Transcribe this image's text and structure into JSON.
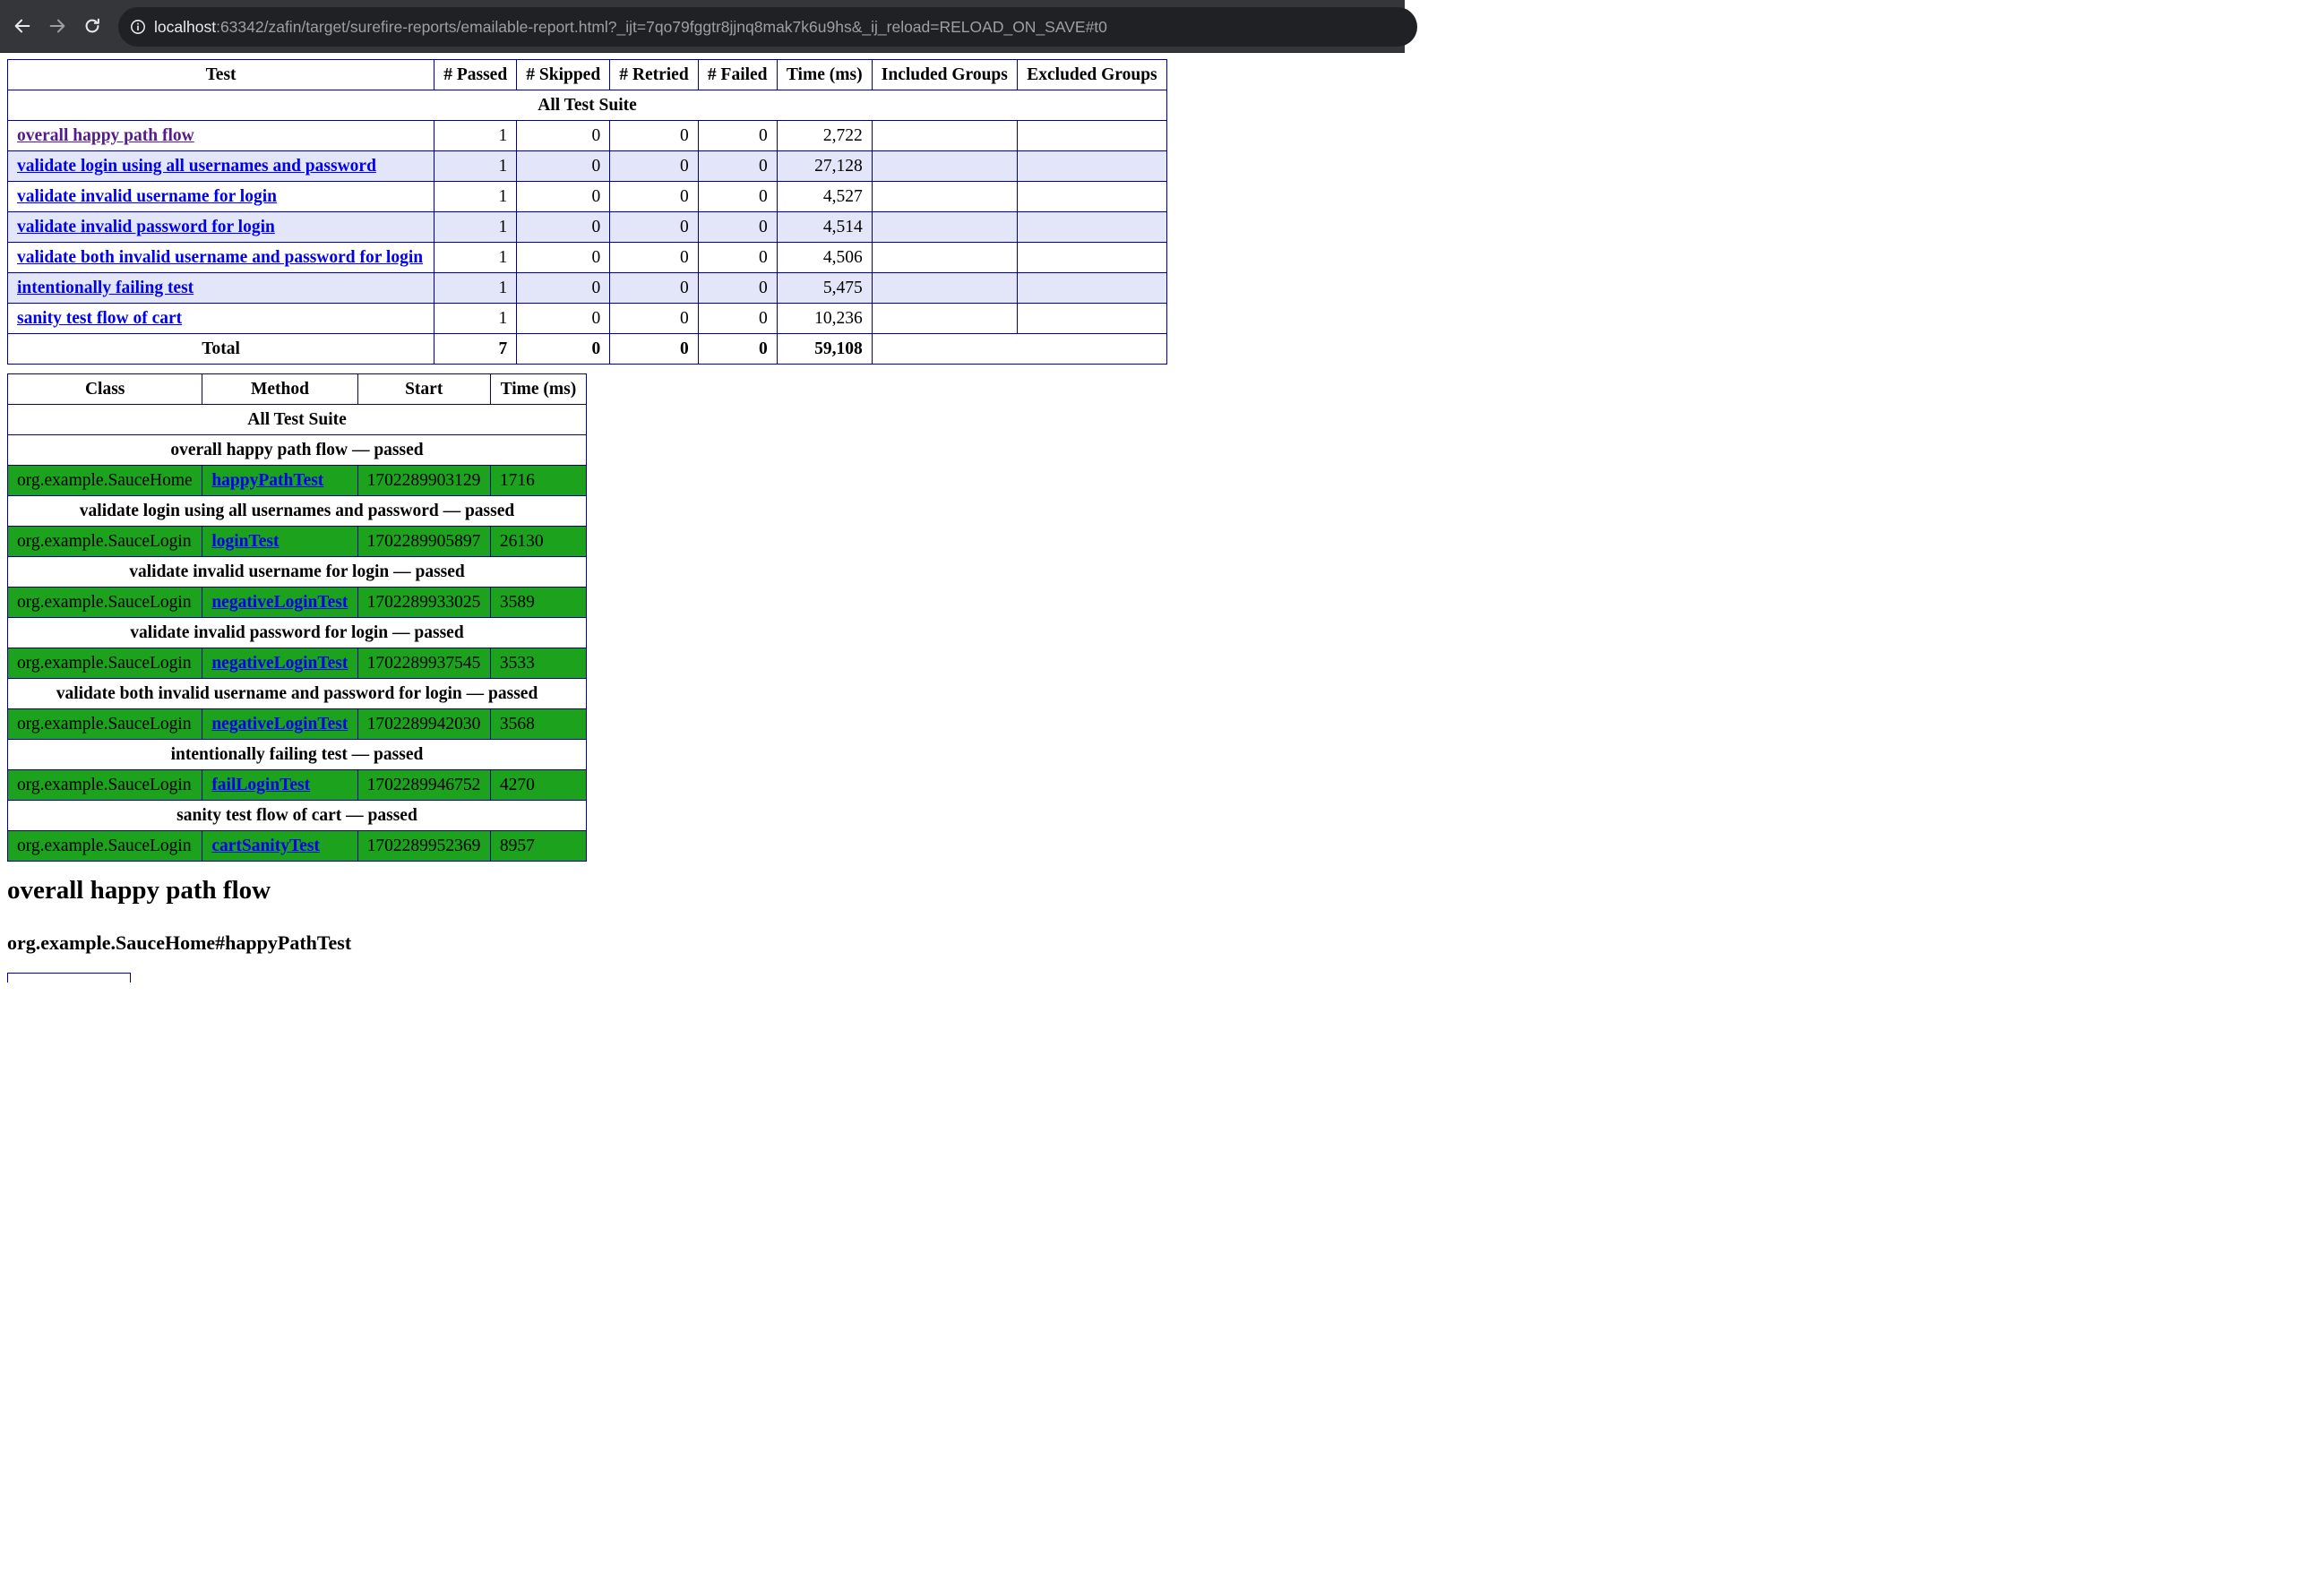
{
  "browser": {
    "url_host": "localhost",
    "url_rest": ":63342/zafin/target/surefire-reports/emailable-report.html?_ijt=7qo79fggtr8jjnq8mak7k6u9hs&_ij_reload=RELOAD_ON_SAVE#t0"
  },
  "summary": {
    "headers": [
      "Test",
      "# Passed",
      "# Skipped",
      "# Retried",
      "# Failed",
      "Time (ms)",
      "Included Groups",
      "Excluded Groups"
    ],
    "suite": "All Test Suite",
    "rows": [
      {
        "name": "overall happy path flow",
        "passed": "1",
        "skipped": "0",
        "retried": "0",
        "failed": "0",
        "time": "2,722"
      },
      {
        "name": "validate login using all usernames and password",
        "passed": "1",
        "skipped": "0",
        "retried": "0",
        "failed": "0",
        "time": "27,128"
      },
      {
        "name": "validate invalid username for login",
        "passed": "1",
        "skipped": "0",
        "retried": "0",
        "failed": "0",
        "time": "4,527"
      },
      {
        "name": "validate invalid password for login",
        "passed": "1",
        "skipped": "0",
        "retried": "0",
        "failed": "0",
        "time": "4,514"
      },
      {
        "name": "validate both invalid username and password for login",
        "passed": "1",
        "skipped": "0",
        "retried": "0",
        "failed": "0",
        "time": "4,506"
      },
      {
        "name": "intentionally failing test",
        "passed": "1",
        "skipped": "0",
        "retried": "0",
        "failed": "0",
        "time": "5,475"
      },
      {
        "name": "sanity test flow of cart",
        "passed": "1",
        "skipped": "0",
        "retried": "0",
        "failed": "0",
        "time": "10,236"
      }
    ],
    "total": {
      "label": "Total",
      "passed": "7",
      "skipped": "0",
      "retried": "0",
      "failed": "0",
      "time": "59,108"
    }
  },
  "detail": {
    "headers": [
      "Class",
      "Method",
      "Start",
      "Time (ms)"
    ],
    "suite": "All Test Suite",
    "groups": [
      {
        "title": "overall happy path flow — passed",
        "class": "org.example.SauceHome",
        "method": "happyPathTest",
        "start": "1702289903129",
        "time": "1716"
      },
      {
        "title": "validate login using all usernames and password — passed",
        "class": "org.example.SauceLogin",
        "method": "loginTest",
        "start": "1702289905897",
        "time": "26130"
      },
      {
        "title": "validate invalid username for login — passed",
        "class": "org.example.SauceLogin",
        "method": "negativeLoginTest",
        "start": "1702289933025",
        "time": "3589"
      },
      {
        "title": "validate invalid password for login — passed",
        "class": "org.example.SauceLogin",
        "method": "negativeLoginTest",
        "start": "1702289937545",
        "time": "3533"
      },
      {
        "title": "validate both invalid username and password for login — passed",
        "class": "org.example.SauceLogin",
        "method": "negativeLoginTest",
        "start": "1702289942030",
        "time": "3568"
      },
      {
        "title": "intentionally failing test — passed",
        "class": "org.example.SauceLogin",
        "method": "failLoginTest",
        "start": "1702289946752",
        "time": "4270"
      },
      {
        "title": "sanity test flow of cart — passed",
        "class": "org.example.SauceLogin",
        "method": "cartSanityTest",
        "start": "1702289952369",
        "time": "8957"
      }
    ]
  },
  "section": {
    "title": "overall happy path flow",
    "method_title": "org.example.SauceHome#happyPathTest"
  },
  "colors": {
    "border": "#00008b",
    "stripe": "#e3e6f8",
    "passed": "#1ca21c",
    "link": "#0000ee",
    "visited": "#551a8b"
  }
}
